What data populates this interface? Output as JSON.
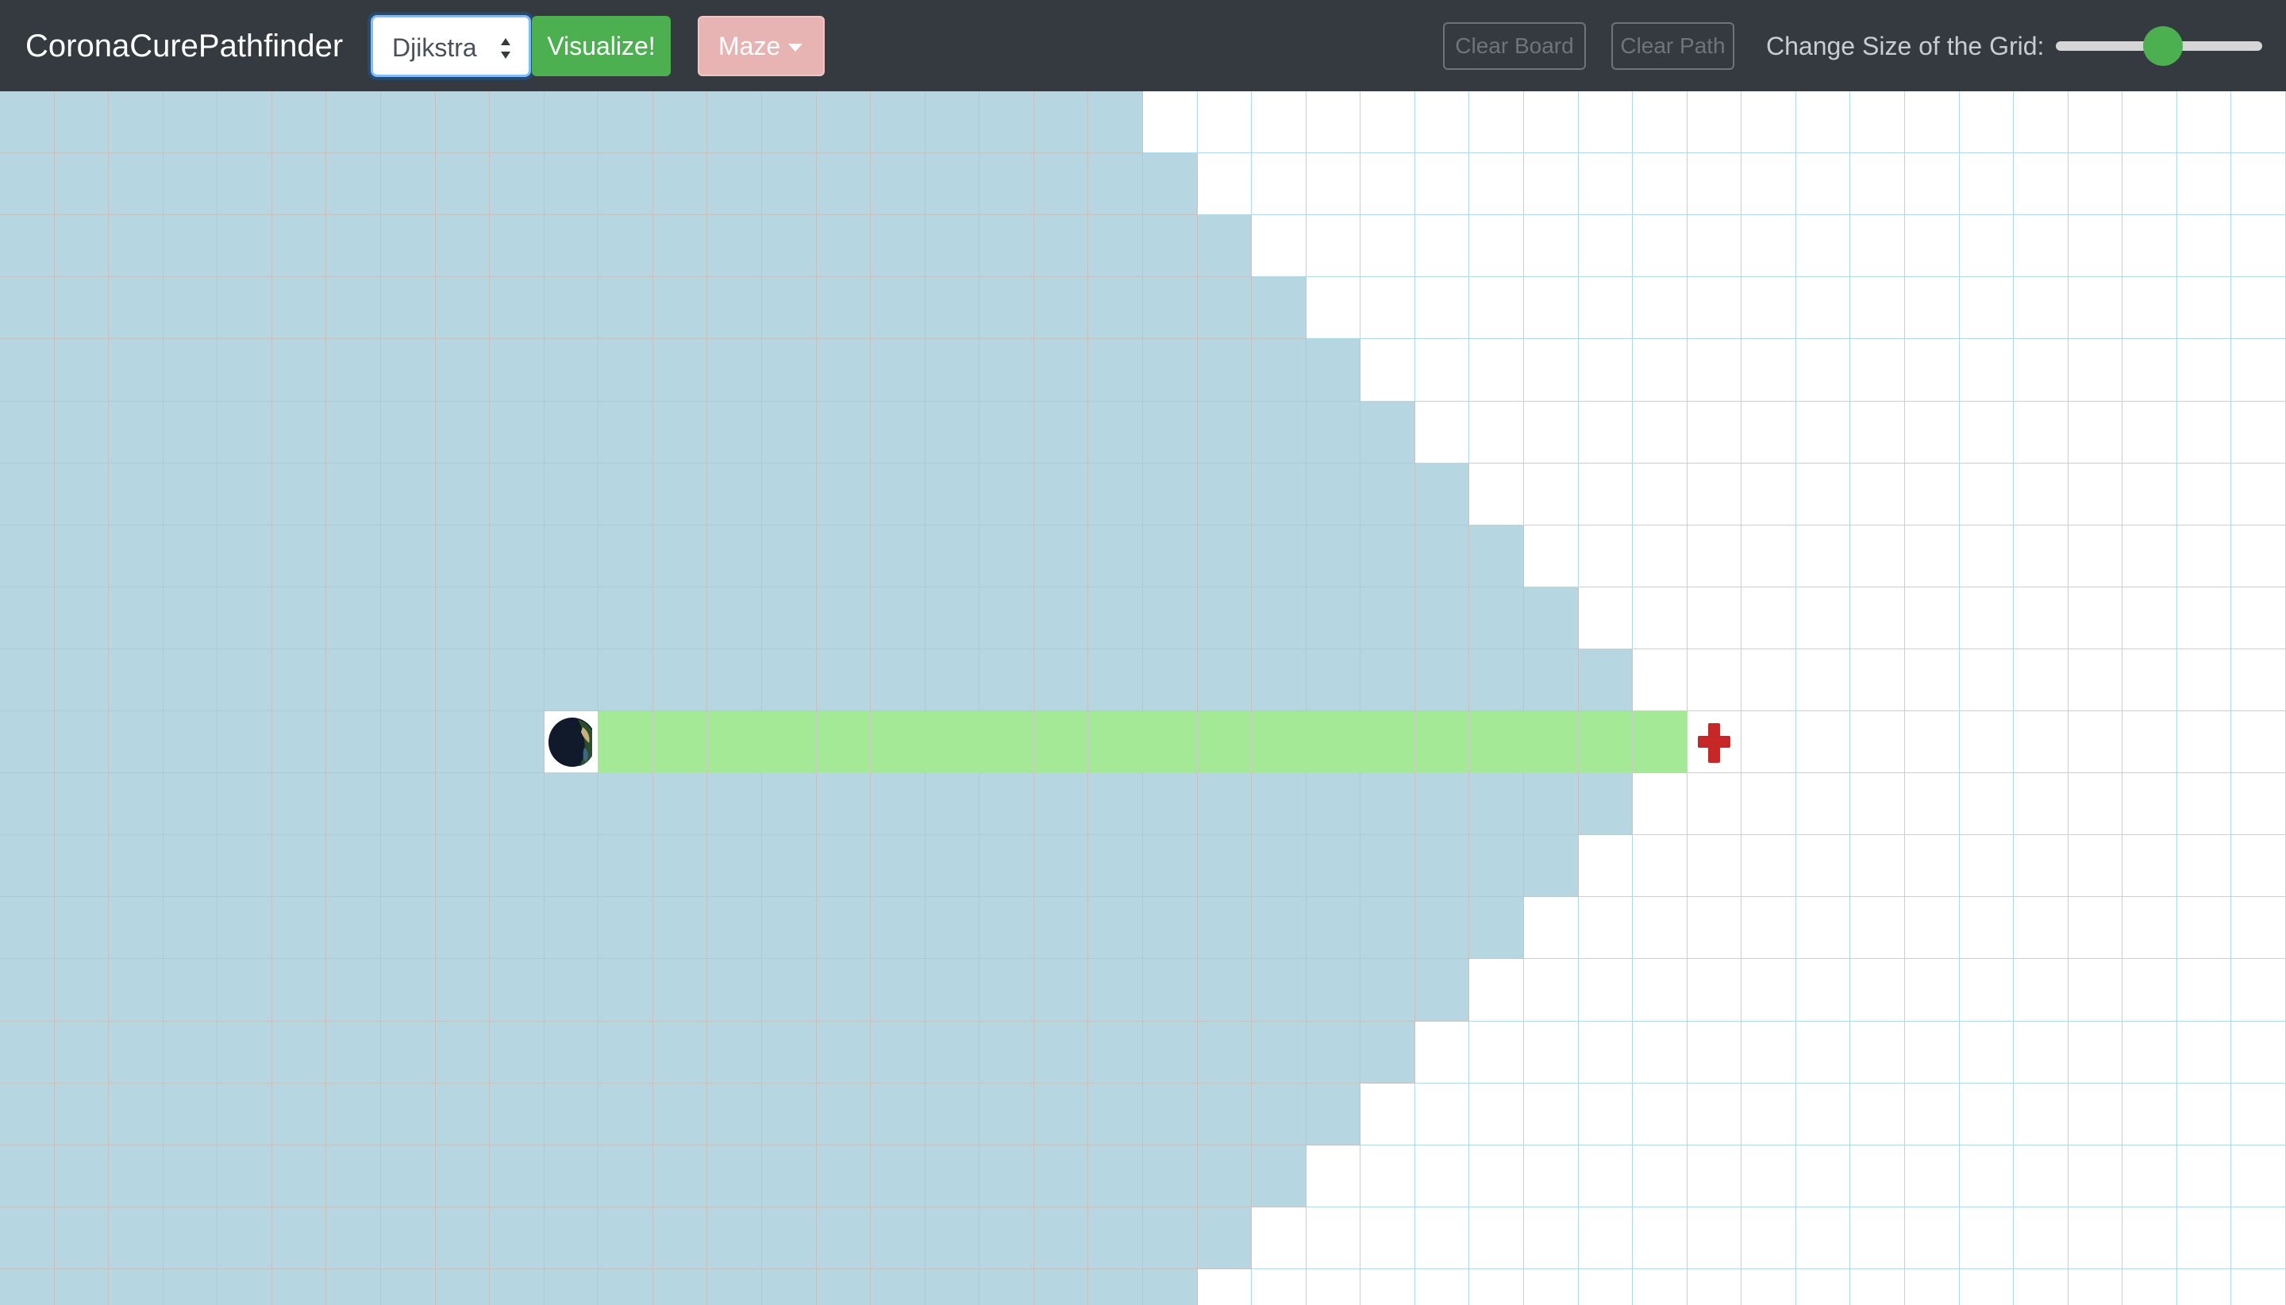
{
  "navbar": {
    "brand": "CoronaCurePathfinder",
    "algorithm_select": {
      "value": "Djikstra"
    },
    "visualize_label": "Visualize!",
    "maze_label": "Maze",
    "clear_board_label": "Clear Board",
    "clear_path_label": "Clear Path",
    "grid_size_label": "Change Size of the Grid:",
    "grid_size_slider_value": 0.52
  },
  "colors": {
    "navbar_bg": "#343a40",
    "visualize_bg": "#4caf50",
    "maze_bg": "#e8b3b3",
    "visited": "#b6d7e2",
    "path": "#a3e996",
    "unvisited": "#ffffff",
    "cure_red": "#c62828"
  },
  "icons": {
    "start": "earth-icon",
    "target": "cure-cross-icon"
  },
  "grid": {
    "cols": 42,
    "rows": 20,
    "start": {
      "row": 10,
      "col": 10
    },
    "target": {
      "row": 10,
      "col": 31
    },
    "visited_col_count_by_row": [
      21,
      22,
      23,
      24,
      25,
      26,
      27,
      28,
      29,
      30,
      30,
      30,
      29,
      28,
      27,
      26,
      25,
      24,
      23,
      22
    ],
    "path": {
      "row": 10,
      "from_col": 11,
      "to_col": 30
    }
  }
}
